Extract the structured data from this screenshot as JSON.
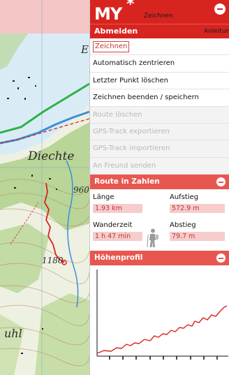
{
  "header": {
    "logo": "MY",
    "logo_star": "*",
    "title": "Zeichnen",
    "logout": "Abmelden",
    "guide": "Anleitung"
  },
  "menu": {
    "items": [
      {
        "label": "Zeichnen",
        "enabled": true,
        "selected": true
      },
      {
        "label": "Automatisch zentrieren",
        "enabled": true
      },
      {
        "label": "Letzter Punkt löschen",
        "enabled": true
      },
      {
        "label": "Zeichnen beenden / speichern",
        "enabled": true
      },
      {
        "label": "Route löschen",
        "enabled": false
      },
      {
        "label": "GPS-Track exportieren",
        "enabled": false
      },
      {
        "label": "GPS-Track importieren",
        "enabled": false
      },
      {
        "label": "An Freund senden",
        "enabled": false
      }
    ]
  },
  "route": {
    "title": "Route in Zahlen",
    "length_label": "Länge",
    "length_value": "1.93 km",
    "ascent_label": "Aufstieg",
    "ascent_value": "572.9 m",
    "time_label": "Wanderzeit",
    "time_value": "1 h 47 min",
    "descent_label": "Abstieg",
    "descent_value": "79.7 m"
  },
  "profile": {
    "title": "Höhenprofil"
  },
  "map": {
    "labels": {
      "lake_letter": "E",
      "place": "Diechte",
      "elev_1": "960",
      "elev_2": "1180",
      "bottom_place": "uhl"
    }
  },
  "colors": {
    "accent_red": "#d8241f",
    "section_red": "#e8574f",
    "value_bg": "#f6cccc",
    "route_red": "#d8241f"
  }
}
